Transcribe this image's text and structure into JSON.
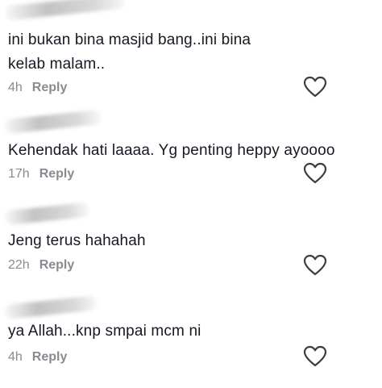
{
  "comments": [
    {
      "text": "ini bukan bina masjid bang..ini bina kelab malam..",
      "time": "4h",
      "reply_label": "Reply",
      "icon": "heart-outline-icon"
    },
    {
      "text": "Kehendak hati laaaa. Yg penting heppy ayoooo",
      "time": "17h",
      "reply_label": "Reply",
      "icon": "heart-outline-icon"
    },
    {
      "text": "Jeng terus hahahah",
      "time": "22h",
      "reply_label": "Reply",
      "icon": "heart-outline-icon"
    },
    {
      "text": "ya Allah...knp smpai mcm ni",
      "time": "4h",
      "reply_label": "Reply",
      "icon": "heart-outline-icon"
    }
  ],
  "colors": {
    "text": "#161823",
    "meta": "#8a8b91",
    "icon": "#3c3c43",
    "background": "#ffffff"
  }
}
